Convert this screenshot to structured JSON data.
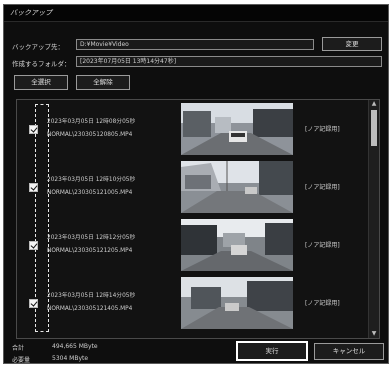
{
  "window": {
    "title": "バックアップ"
  },
  "form": {
    "dest_label": "バックアップ先：",
    "dest_value": "D:¥Movie¥Video",
    "change_button": "変更",
    "folder_label": "作成するフォルダ：",
    "folder_value": "[2023年07月05日 13時14分47秒]"
  },
  "buttons": {
    "select_all": "全選択",
    "deselect_all": "全解除",
    "execute": "実行",
    "cancel": "キャンセル"
  },
  "files": [
    {
      "datetime": "2023年03月05日 12時08分05秒",
      "filename": "NORMAL\\230305120805.MP4",
      "kind": "[ノア記録用]",
      "checked": true
    },
    {
      "datetime": "2023年03月05日 12時10分05秒",
      "filename": "NORMAL\\230305121005.MP4",
      "kind": "[ノア記録用]",
      "checked": true
    },
    {
      "datetime": "2023年03月05日 12時12分05秒",
      "filename": "NORMAL\\230305121205.MP4",
      "kind": "[ノア記録用]",
      "checked": true
    },
    {
      "datetime": "2023年03月05日 12時14分05秒",
      "filename": "NORMAL\\230305121405.MP4",
      "kind": "[ノア記録用]",
      "checked": true
    }
  ],
  "summary": {
    "total_label": "合計",
    "total_value": "494,665 MByte",
    "required_label": "必要量",
    "required_value": "5304 MByte"
  },
  "colors": {
    "window_bg": "#0e0e0e",
    "field_border": "#8a8a8a",
    "highlight_border": "#ffffff"
  }
}
